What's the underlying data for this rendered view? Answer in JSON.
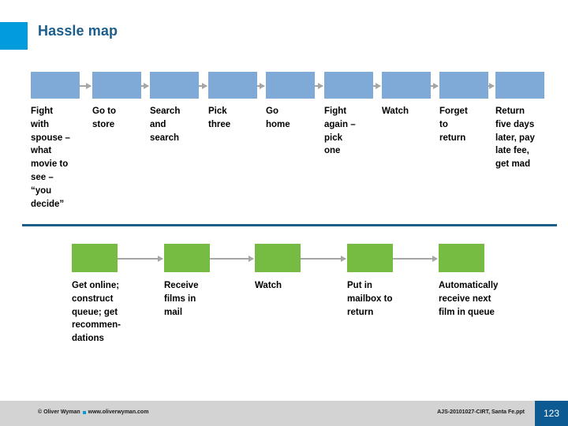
{
  "title": "Hassle map",
  "theme": {
    "accent_cyan": "#029CDC",
    "title_blue": "#1B5E8C",
    "box_blue": "#7FA9D6",
    "box_green": "#76BC43",
    "arrow_gray": "#A6A6A6",
    "divider_blue": "#1B5E8C",
    "footer_gray": "#D3D3D3",
    "page_box_blue": "#0D5A93"
  },
  "rows": [
    {
      "name": "hassle-row-blue",
      "color": "#7FA9D6",
      "steps": [
        {
          "label": "Fight\nwith\nspouse –\nwhat\nmovie to\nsee –\n“you\ndecide”"
        },
        {
          "label": "Go to\nstore"
        },
        {
          "label": "Search\nand\nsearch"
        },
        {
          "label": "Pick\nthree"
        },
        {
          "label": "Go\nhome"
        },
        {
          "label": "Fight\nagain –\npick\none"
        },
        {
          "label": "Watch"
        },
        {
          "label": "Forget\nto\nreturn"
        },
        {
          "label": "Return\nfive days\nlater, pay\nlate fee,\nget mad"
        }
      ]
    },
    {
      "name": "hassle-row-green",
      "color": "#76BC43",
      "steps": [
        {
          "label": "Get online;\nconstruct\nqueue; get\nrecommen-\ndations"
        },
        {
          "label": "Receive\nfilms in\nmail"
        },
        {
          "label": "Watch"
        },
        {
          "label": "Put in\nmailbox to\nreturn"
        },
        {
          "label": "Automatically\nreceive next\nfilm in queue"
        }
      ]
    }
  ],
  "footer": {
    "copyright": "© Oliver Wyman",
    "website": "www.oliverwyman.com",
    "filename": "AJS-20101027-CIRT, Santa Fe.ppt",
    "page_number": "123"
  }
}
